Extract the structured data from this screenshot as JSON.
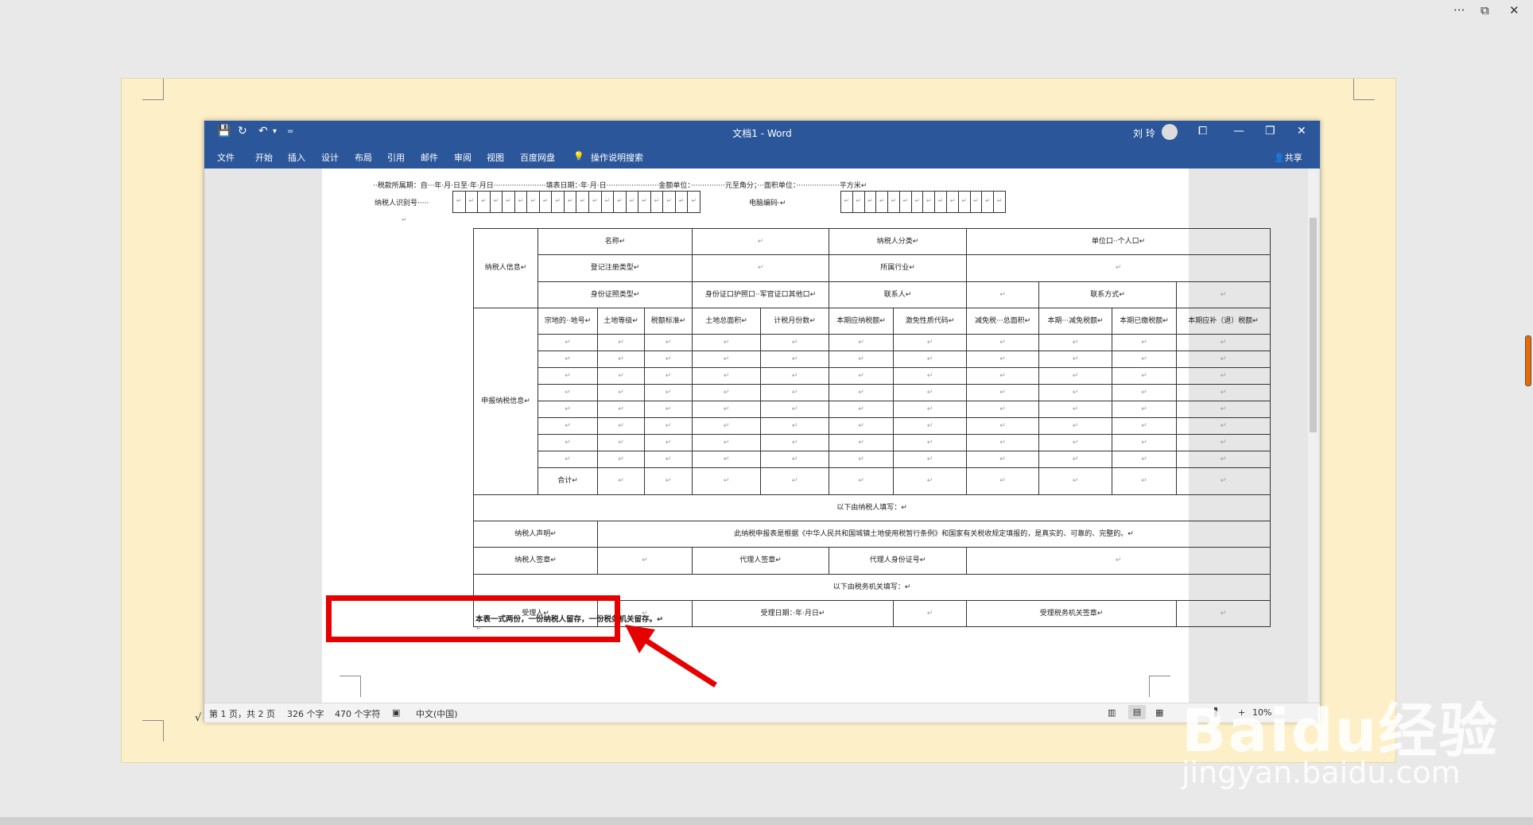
{
  "outer": {
    "more": "···",
    "restore": "⧉",
    "close": "✕"
  },
  "watermark": {
    "brand": "Baidu经验",
    "url": "jingyan.baidu.com"
  },
  "window": {
    "title": "文档1 - Word",
    "user": "刘 玲",
    "quick_access": {
      "save": "💾",
      "redo": "↻",
      "undo": "↶",
      "more": "▾",
      "customize": "="
    },
    "controls": {
      "layout": "⧠",
      "minimize": "—",
      "restore": "❐",
      "close": "✕"
    },
    "tabs": [
      "文件",
      "开始",
      "插入",
      "设计",
      "布局",
      "引用",
      "邮件",
      "审阅",
      "视图",
      "百度网盘"
    ],
    "tell_me": "操作说明搜索",
    "share": "共享"
  },
  "document": {
    "header_line1": "··税款所属期：自···年·月·日至·年·月日·······················填表日期：·年·月·日·······················金额单位：···············元至角分；···面积单位：···················平方米↵",
    "taxpayer_id_label": "纳税人识别号·····",
    "computer_code_label": "电脑编码·↵",
    "section_info": "纳税人信息↵",
    "name": "名称↵",
    "taxpayer_category": "纳税人分类↵",
    "unit_person": "单位口··个人口↵",
    "reg_type": "登记注册类型↵",
    "industry": "所属行业↵",
    "id_type": "身份证照类型↵",
    "id_options": "身份证口护照口··军官证口其他口↵",
    "contact": "联系人↵",
    "contact_method": "联系方式↵",
    "section_declare": "申报纳税信息↵",
    "columns": [
      "宗地的··地号↵",
      "土地等级↵",
      "税额标准↵",
      "土地总面积↵",
      "计税月份数↵",
      "本期应纳税额↵",
      "激免性质代码↵",
      "减免税···总面积↵",
      "本期···减免税额↵",
      "本期已缴税额↵",
      "本期应补（退）税额↵"
    ],
    "total": "合计↵",
    "cell_mark": "↵",
    "by_taxpayer": "以下由纳税人填写：↵",
    "statement_label": "纳税人声明↵",
    "statement_text": "此纳税申报表是根据《中华人民共和国城镇土地使用税暂行条例》和国家有关税收规定填报的，是真实的、可靠的、完整的。↵",
    "taxpayer_sign": "纳税人签章↵",
    "agent_sign": "代理人签章↵",
    "agent_id": "代理人身份证号↵",
    "by_tax_office": "以下由税务机关填写：↵",
    "acceptor": "受理人↵",
    "accept_date": "受理日期：·年·月日↵",
    "office_stamp": "受理税务机关签章↵",
    "footer_note": "本表一式两份，一份纳税人留存，一份税务机关留存。↵"
  },
  "status": {
    "page": "第 1 页，共 2 页",
    "words": "326 个字",
    "chars": "470 个字符",
    "lang": "中文(中国)",
    "zoom": "10%"
  }
}
